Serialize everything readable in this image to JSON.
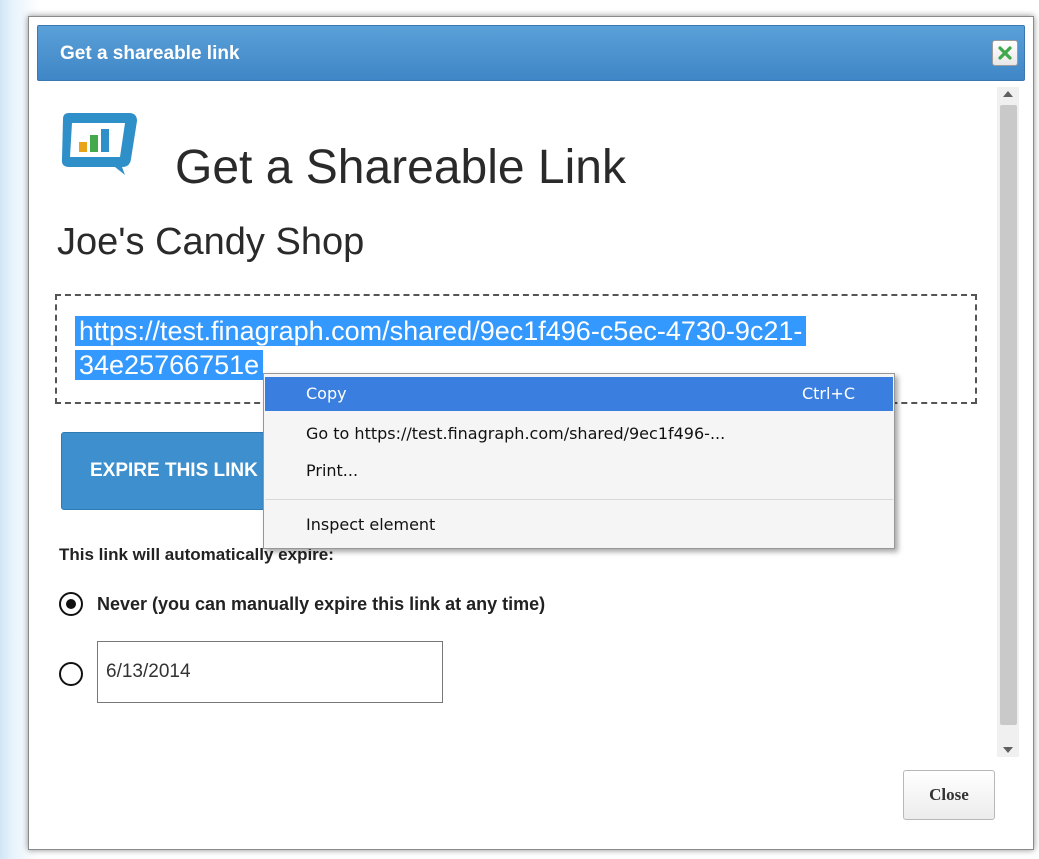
{
  "dialog": {
    "title": "Get a shareable link",
    "heading": "Get a Shareable Link",
    "subheading": "Joe's Candy Shop",
    "link_line1": "https://test.finagraph.com/shared/9ec1f496-c5ec-4730-9c21-",
    "link_line2": "34e25766751e",
    "expire_button": "EXPIRE THIS LINK",
    "expire_label": "This link will automatically expire:",
    "never_label": "Never (you can manually expire this link at any time)",
    "date_value": "6/13/2014",
    "close_button": "Close"
  },
  "context_menu": {
    "items": [
      {
        "label": "Copy",
        "shortcut": "Ctrl+C"
      },
      {
        "label": "Go to https://test.finagraph.com/shared/9ec1f496-..."
      },
      {
        "label": "Print..."
      },
      {
        "label": "Inspect element"
      }
    ]
  },
  "colors": {
    "accent": "#3d8fce",
    "selection": "#3399ff",
    "menu_highlight": "#3a7fe0",
    "close_icon": "#3ea84a"
  },
  "icons": [
    "close-icon",
    "finagraph-logo",
    "radio-checked",
    "radio-unchecked"
  ]
}
